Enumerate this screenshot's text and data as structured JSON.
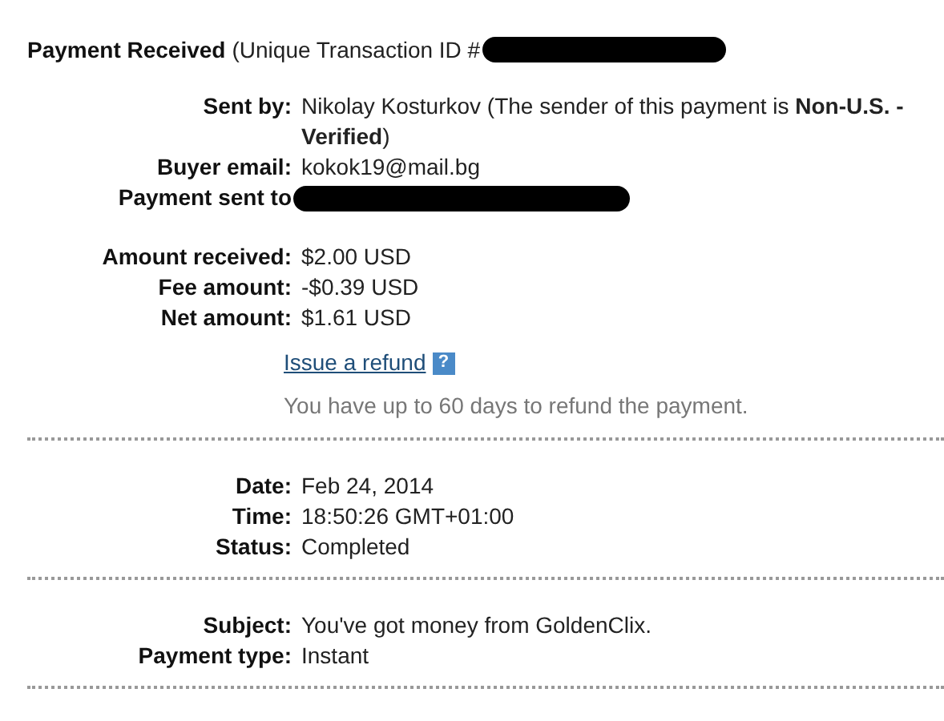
{
  "header": {
    "title": "Payment Received",
    "subtitle": "(Unique Transaction ID #",
    "id_redacted": true
  },
  "sections": [
    {
      "rows": [
        {
          "kind": "rich",
          "label": "Sent by:",
          "value": "Nikolay Kosturkov (The sender of this payment is **Non-U.S. - Verified**)"
        },
        {
          "kind": "text",
          "label": "Buyer email:",
          "value": "kokok19@mail.bg"
        },
        {
          "kind": "redacted",
          "label": "Payment sent to"
        }
      ]
    },
    {
      "rows": [
        {
          "kind": "text",
          "label": "Amount received:",
          "value": "$2.00 USD"
        },
        {
          "kind": "text",
          "label": "Fee amount:",
          "value": "-$0.39 USD"
        },
        {
          "kind": "text",
          "label": "Net amount:",
          "value": "$1.61 USD"
        }
      ],
      "refund": {
        "link": "Issue a refund",
        "help": "?",
        "note": "You have up to 60 days to refund the payment."
      },
      "divider": true
    },
    {
      "rows": [
        {
          "kind": "text",
          "label": "Date:",
          "value": "Feb 24, 2014"
        },
        {
          "kind": "text",
          "label": "Time:",
          "value": "18:50:26 GMT+01:00"
        },
        {
          "kind": "text",
          "label": "Status:",
          "value": "Completed"
        }
      ],
      "divider": true
    },
    {
      "rows": [
        {
          "kind": "text",
          "label": "Subject:",
          "value": "You've got money from GoldenClix."
        },
        {
          "kind": "text",
          "label": "Payment type:",
          "value": "Instant"
        }
      ],
      "divider": true
    }
  ]
}
